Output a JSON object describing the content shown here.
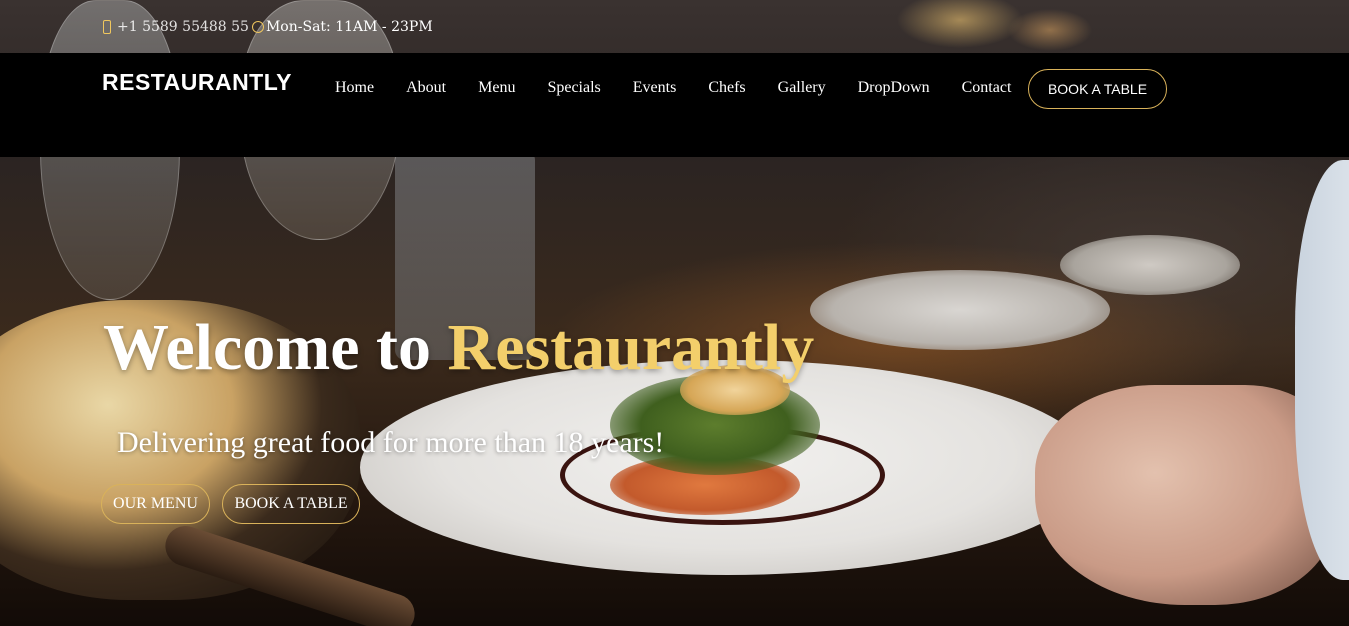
{
  "topbar": {
    "phone_icon": "phone-icon",
    "phone": "+1 5589 55488 55",
    "clock_icon": "clock-icon",
    "hours": "Mon-Sat: 11AM - 23PM"
  },
  "header": {
    "logo": "RESTAURANTLY",
    "nav": [
      {
        "label": "Home"
      },
      {
        "label": "About"
      },
      {
        "label": "Menu"
      },
      {
        "label": "Specials"
      },
      {
        "label": "Events"
      },
      {
        "label": "Chefs"
      },
      {
        "label": "Gallery"
      },
      {
        "label": "DropDown"
      },
      {
        "label": "Contact"
      }
    ],
    "book_button": "BOOK A TABLE"
  },
  "hero": {
    "title_prefix": "Welcome to ",
    "title_accent": "Restaurantly",
    "subtitle": "Delivering great food for more than 18 years!",
    "menu_button": "OUR MENU",
    "book_button": "BOOK A TABLE"
  },
  "colors": {
    "accent": "#f3cf6b",
    "button_border": "#d9b25a",
    "nav_background": "#000000"
  }
}
